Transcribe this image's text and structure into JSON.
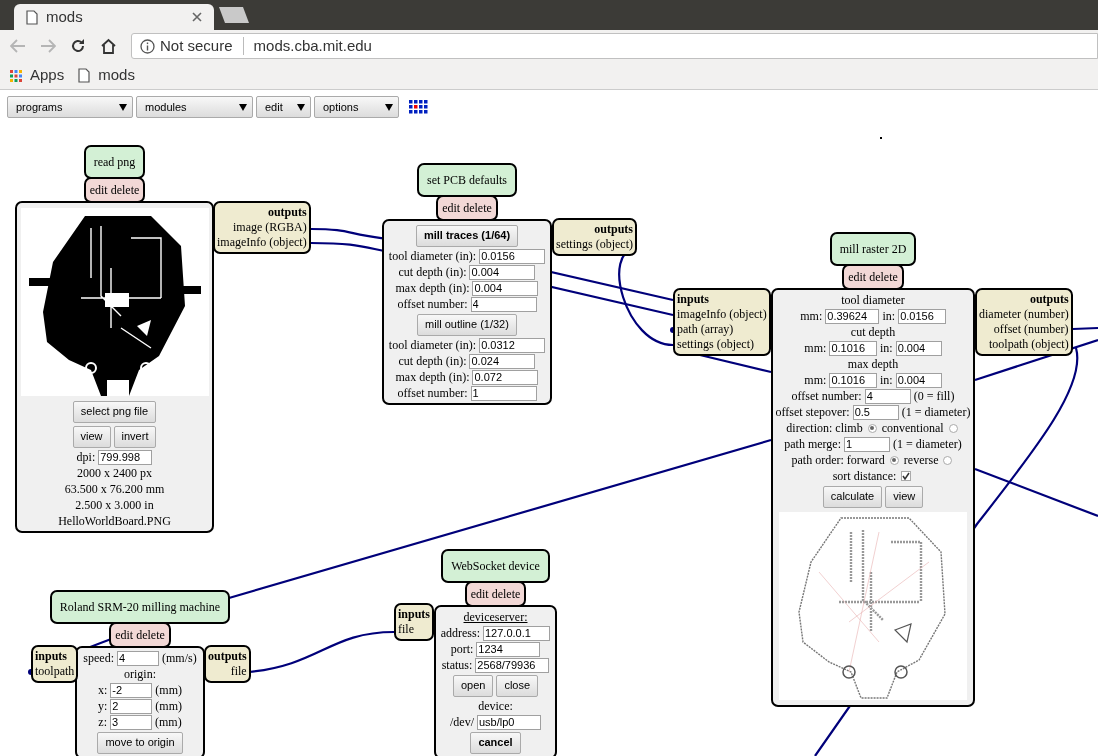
{
  "browser": {
    "tabs": [
      {
        "title": "mods",
        "selected": true
      }
    ],
    "address": {
      "security": "Not secure",
      "url": "mods.cba.mit.edu"
    },
    "bookmarks": [
      "Apps",
      "mods"
    ]
  },
  "menus": [
    "programs",
    "modules",
    "edit",
    "options"
  ],
  "modules": [
    {
      "title": "read png",
      "actions": "edit delete",
      "outputs": {
        "heading": "outputs",
        "items": [
          "image (RGBA)",
          "imageInfo (object)"
        ]
      },
      "lines": [
        {
          "parts": [
            {
              "kind": "picture"
            }
          ]
        },
        {
          "parts": [
            {
              "kind": "button",
              "text": "select png file"
            }
          ]
        },
        {
          "parts": [
            {
              "kind": "button",
              "text": "view"
            },
            {
              "kind": "button",
              "text": "invert"
            }
          ]
        },
        {
          "parts": [
            {
              "kind": "text",
              "text": "dpi:"
            },
            {
              "kind": "field",
              "value": "799.998"
            }
          ]
        },
        {
          "parts": [
            {
              "kind": "text",
              "text": "2000 x 2400 px"
            }
          ]
        },
        {
          "parts": [
            {
              "kind": "text",
              "text": "63.500 x 76.200 mm"
            }
          ]
        },
        {
          "parts": [
            {
              "kind": "text",
              "text": "2.500 x 3.000 in"
            }
          ]
        },
        {
          "parts": [
            {
              "kind": "text",
              "text": "HelloWorldBoard.PNG"
            }
          ]
        }
      ]
    },
    {
      "title": "set PCB defaults",
      "actions": "edit delete",
      "outputs": {
        "heading": "outputs",
        "items": [
          "settings (object)"
        ]
      },
      "lines": [
        {
          "parts": [
            {
              "kind": "strong_button",
              "text": "mill traces (1/64)"
            }
          ]
        },
        {
          "parts": [
            {
              "kind": "text",
              "text": "tool diameter (in):"
            },
            {
              "kind": "field",
              "value": "0.0156"
            }
          ]
        },
        {
          "parts": [
            {
              "kind": "text",
              "text": "cut depth (in):"
            },
            {
              "kind": "field",
              "value": "0.004"
            }
          ]
        },
        {
          "parts": [
            {
              "kind": "text",
              "text": "max depth (in):"
            },
            {
              "kind": "field",
              "value": "0.004"
            }
          ]
        },
        {
          "parts": [
            {
              "kind": "text",
              "text": "offset number:"
            },
            {
              "kind": "field",
              "value": "4"
            }
          ]
        },
        {
          "parts": [
            {
              "kind": "button",
              "text": "mill outline (1/32)"
            }
          ]
        },
        {
          "parts": [
            {
              "kind": "text",
              "text": "tool diameter (in):"
            },
            {
              "kind": "field",
              "value": "0.0312"
            }
          ]
        },
        {
          "parts": [
            {
              "kind": "text",
              "text": "cut depth (in):"
            },
            {
              "kind": "field",
              "value": "0.024"
            }
          ]
        },
        {
          "parts": [
            {
              "kind": "text",
              "text": "max depth (in):"
            },
            {
              "kind": "field",
              "value": "0.072"
            }
          ]
        },
        {
          "parts": [
            {
              "kind": "text",
              "text": "offset number:"
            },
            {
              "kind": "field",
              "value": "1"
            }
          ]
        }
      ]
    },
    {
      "title": "mill raster 2D",
      "actions": "edit delete",
      "inputs": {
        "heading": "inputs",
        "items": [
          "imageInfo (object)",
          "path (array)",
          "settings (object)"
        ]
      },
      "outputs": {
        "heading": "outputs",
        "items": [
          "diameter (number)",
          "offset (number)",
          "toolpath (object)"
        ]
      },
      "lines": [
        {
          "parts": [
            {
              "kind": "text",
              "text": "tool diameter"
            }
          ]
        },
        {
          "parts": [
            {
              "kind": "text",
              "text": "mm:"
            },
            {
              "kind": "field",
              "value": "0.39624"
            },
            {
              "kind": "text",
              "text": "in:"
            },
            {
              "kind": "field",
              "value": "0.0156"
            }
          ]
        },
        {
          "parts": [
            {
              "kind": "text",
              "text": "cut depth"
            }
          ]
        },
        {
          "parts": [
            {
              "kind": "text",
              "text": "mm:"
            },
            {
              "kind": "field",
              "value": "0.1016"
            },
            {
              "kind": "text",
              "text": "in:"
            },
            {
              "kind": "field",
              "value": "0.004"
            }
          ]
        },
        {
          "parts": [
            {
              "kind": "text",
              "text": "max depth"
            }
          ]
        },
        {
          "parts": [
            {
              "kind": "text",
              "text": "mm:"
            },
            {
              "kind": "field",
              "value": "0.1016"
            },
            {
              "kind": "text",
              "text": "in:"
            },
            {
              "kind": "field",
              "value": "0.004"
            }
          ]
        },
        {
          "parts": [
            {
              "kind": "text",
              "text": "offset number:"
            },
            {
              "kind": "field",
              "value": "4"
            },
            {
              "kind": "text",
              "text": "(0 = fill)"
            }
          ]
        },
        {
          "parts": [
            {
              "kind": "text",
              "text": "offset stepover:"
            },
            {
              "kind": "field",
              "value": "0.5"
            },
            {
              "kind": "text",
              "text": "(1 = diameter)"
            }
          ]
        },
        {
          "parts": [
            {
              "kind": "text",
              "text": "direction: climb"
            },
            {
              "kind": "radio",
              "selected": true
            },
            {
              "kind": "text",
              "text": "conventional"
            },
            {
              "kind": "radio",
              "selected": false
            }
          ]
        },
        {
          "parts": [
            {
              "kind": "text",
              "text": "path merge:"
            },
            {
              "kind": "field",
              "value": "1"
            },
            {
              "kind": "text",
              "text": "(1 = diameter)"
            }
          ]
        },
        {
          "parts": [
            {
              "kind": "text",
              "text": "path order: forward"
            },
            {
              "kind": "radio",
              "selected": true
            },
            {
              "kind": "text",
              "text": "reverse"
            },
            {
              "kind": "radio",
              "selected": false
            }
          ]
        },
        {
          "parts": [
            {
              "kind": "text",
              "text": "sort distance:"
            },
            {
              "kind": "checkbox",
              "checked": true
            }
          ]
        },
        {
          "parts": [
            {
              "kind": "button",
              "text": "calculate"
            },
            {
              "kind": "button",
              "text": "view"
            }
          ]
        },
        {
          "parts": [
            {
              "kind": "toolpath"
            }
          ]
        }
      ]
    },
    {
      "title": "Roland SRM-20 milling machine",
      "actions": "edit delete",
      "inputs": {
        "heading": "inputs",
        "items": [
          "toolpath"
        ]
      },
      "outputs": {
        "heading": "outputs",
        "items": [
          "file"
        ]
      },
      "lines": [
        {
          "parts": [
            {
              "kind": "text",
              "text": "speed:"
            },
            {
              "kind": "field",
              "value": "4"
            },
            {
              "kind": "text",
              "text": "(mm/s)"
            }
          ]
        },
        {
          "parts": [
            {
              "kind": "text",
              "text": "origin:"
            }
          ]
        },
        {
          "parts": [
            {
              "kind": "text",
              "text": "x:"
            },
            {
              "kind": "field",
              "value": "-2"
            },
            {
              "kind": "text",
              "text": "(mm)"
            }
          ]
        },
        {
          "parts": [
            {
              "kind": "text",
              "text": "y:"
            },
            {
              "kind": "field",
              "value": "2"
            },
            {
              "kind": "text",
              "text": "(mm)"
            }
          ]
        },
        {
          "parts": [
            {
              "kind": "text",
              "text": "z:"
            },
            {
              "kind": "field",
              "value": "3"
            },
            {
              "kind": "text",
              "text": "(mm)"
            }
          ]
        },
        {
          "parts": [
            {
              "kind": "button",
              "text": "move to origin"
            }
          ]
        }
      ]
    },
    {
      "title": "WebSocket device",
      "actions": "edit delete",
      "inputs": {
        "heading": "inputs",
        "items": [
          "file"
        ]
      },
      "lines": [
        {
          "parts": [
            {
              "kind": "underlined",
              "text": "deviceserver:"
            }
          ]
        },
        {
          "parts": [
            {
              "kind": "text",
              "text": "address:"
            },
            {
              "kind": "field",
              "value": "127.0.0.1"
            }
          ]
        },
        {
          "parts": [
            {
              "kind": "text",
              "text": "port:"
            },
            {
              "kind": "field",
              "value": "1234"
            }
          ]
        },
        {
          "parts": [
            {
              "kind": "text",
              "text": "status:"
            },
            {
              "kind": "field",
              "value": "2568/79936"
            }
          ]
        },
        {
          "parts": [
            {
              "kind": "button",
              "text": "open"
            },
            {
              "kind": "button",
              "text": "close"
            }
          ]
        },
        {
          "parts": [
            {
              "kind": "text",
              "text": "device:"
            }
          ]
        },
        {
          "parts": [
            {
              "kind": "text",
              "text": "/dev/"
            },
            {
              "kind": "field",
              "value": "usb/lp0"
            }
          ]
        },
        {
          "parts": [
            {
              "kind": "strong_button",
              "text": "cancel"
            }
          ]
        }
      ]
    }
  ]
}
